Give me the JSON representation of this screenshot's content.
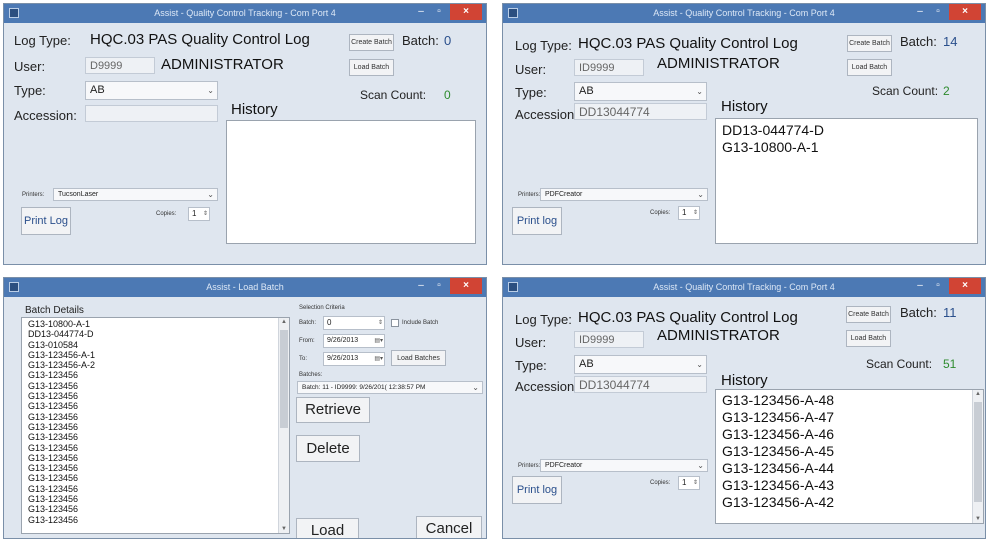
{
  "win1": {
    "title": "Assist - Quality Control Tracking - Com Port 4",
    "log_type_label": "Log Type:",
    "log_type_value": "HQC.03 PAS Quality Control Log",
    "create_batch": "Create Batch",
    "batch_label": "Batch:",
    "batch_value": "0",
    "user_label": "User:",
    "user_id": "D9999",
    "user_name": "ADMINISTRATOR",
    "load_batch": "Load Batch",
    "type_label": "Type:",
    "type_value": "AB",
    "scan_count_label": "Scan Count:",
    "scan_count_value": "0",
    "accession_label": "Accession:",
    "accession_value": "",
    "history_label": "History",
    "history": [],
    "printers_label": "Printers:",
    "printer_value": "TucsonLaser",
    "copies_label": "Copies:",
    "copies_value": "1",
    "print_log": "Print Log"
  },
  "win2": {
    "title": "Assist - Quality Control Tracking - Com Port 4",
    "log_type_label": "Log Type:",
    "log_type_value": "HQC.03 PAS Quality Control Log",
    "create_batch": "Create Batch",
    "batch_label": "Batch:",
    "batch_value": "14",
    "user_label": "User:",
    "user_id": "ID9999",
    "user_name": "ADMINISTRATOR",
    "load_batch": "Load Batch",
    "type_label": "Type:",
    "type_value": "AB",
    "scan_count_label": "Scan Count:",
    "scan_count_value": "2",
    "accession_label": "Accession:",
    "accession_value": "DD13044774",
    "history_label": "History",
    "history": [
      "DD13-044774-D",
      "G13-10800-A-1"
    ],
    "printers_label": "Printers:",
    "printer_value": "PDFCreator",
    "copies_label": "Copies:",
    "copies_value": "1",
    "print_log": "Print log"
  },
  "win3": {
    "title": "Assist - Load Batch",
    "batch_details_label": "Batch Details",
    "batch_details": [
      "G13-10800-A-1",
      "DD13-044774-D",
      "G13-010584",
      "G13-123456-A-1",
      "G13-123456-A-2",
      "G13-123456",
      "G13-123456",
      "G13-123456",
      "G13-123456",
      "G13-123456",
      "G13-123456",
      "G13-123456",
      "G13-123456",
      "G13-123456",
      "G13-123456",
      "G13-123456",
      "G13-123456",
      "G13-123456",
      "G13-123456",
      "G13-123456"
    ],
    "selection_criteria_label": "Selection Criteria",
    "batch_label": "Batch:",
    "batch_value": "0",
    "include_batch_label": "Include Batch",
    "from_label": "From:",
    "from_value": "9/26/2013",
    "to_label": "To:",
    "to_value": "9/26/2013",
    "load_batches": "Load Batches",
    "batches_label": "Batches:",
    "batches_value": "Batch: 11 - ID9999: 9/26/201( 12:38:57 PM",
    "retrieve": "Retrieve",
    "delete": "Delete",
    "load": "Load",
    "cancel": "Cancel"
  },
  "win4": {
    "title": "Assist - Quality Control Tracking - Com Port 4",
    "log_type_label": "Log Type:",
    "log_type_value": "HQC.03 PAS Quality Control Log",
    "create_batch": "Create Batch",
    "batch_label": "Batch:",
    "batch_value": "11",
    "user_label": "User:",
    "user_id": "ID9999",
    "user_name": "ADMINISTRATOR",
    "load_batch": "Load Batch",
    "type_label": "Type:",
    "type_value": "AB",
    "scan_count_label": "Scan Count:",
    "scan_count_value": "51",
    "accession_label": "Accession:",
    "accession_value": "DD13044774",
    "history_label": "History",
    "history": [
      "G13-123456-A-48",
      "G13-123456-A-47",
      "G13-123456-A-46",
      "G13-123456-A-45",
      "G13-123456-A-44",
      "G13-123456-A-43",
      "G13-123456-A-42"
    ],
    "printers_label": "Printers:",
    "printer_value": "PDFCreator",
    "copies_label": "Copies:",
    "copies_value": "1",
    "print_log": "Print log"
  },
  "colors": {
    "titlebar": "#4c79b4",
    "window_bg": "#dfe6ef",
    "close": "#d14434",
    "scan_green": "#2e8b2e",
    "batch_blue": "#2a4f8c"
  },
  "icons": {
    "app": "app-icon",
    "minimize": "minimize-icon",
    "maximize": "maximize-icon",
    "close": "close-icon",
    "dropdown": "chevron-down-icon",
    "calendar": "calendar-icon"
  }
}
